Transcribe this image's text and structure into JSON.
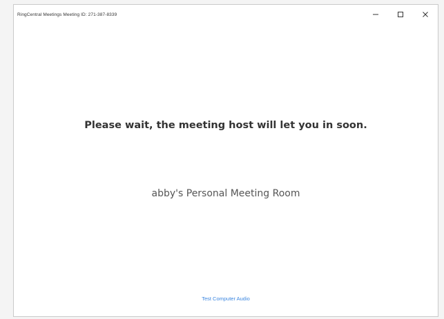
{
  "window": {
    "title": "RingCentral Meetings Meeting ID: 271-387-8339"
  },
  "waiting_room": {
    "message": "Please wait, the meeting host will let you in soon.",
    "room_name": "abby's Personal Meeting Room",
    "test_audio_label": "Test Computer Audio"
  },
  "colors": {
    "link": "#3b86e0",
    "message_text": "#333333",
    "room_text": "#555555"
  },
  "icons": {
    "minimize": "minimize-icon",
    "maximize": "maximize-icon",
    "close": "close-icon"
  }
}
